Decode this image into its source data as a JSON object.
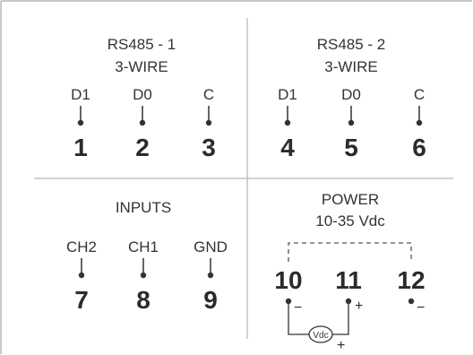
{
  "colors": {
    "border": "#b8b8b8",
    "divider": "#c4c4c4",
    "text": "#333333",
    "dashed_wire": "#555555"
  },
  "sections": {
    "rs485_1": {
      "title": "RS485 - 1",
      "subtitle": "3-WIRE",
      "pins": [
        {
          "label": "D1",
          "number": "1"
        },
        {
          "label": "D0",
          "number": "2"
        },
        {
          "label": "C",
          "number": "3"
        }
      ]
    },
    "rs485_2": {
      "title": "RS485 - 2",
      "subtitle": "3-WIRE",
      "pins": [
        {
          "label": "D1",
          "number": "4"
        },
        {
          "label": "D0",
          "number": "5"
        },
        {
          "label": "C",
          "number": "6"
        }
      ]
    },
    "inputs": {
      "title": "INPUTS",
      "pins": [
        {
          "label": "CH2",
          "number": "7"
        },
        {
          "label": "CH1",
          "number": "8"
        },
        {
          "label": "GND",
          "number": "9"
        }
      ]
    },
    "power": {
      "title": "POWER",
      "subtitle": "10-35 Vdc",
      "terminals": [
        {
          "number": "10",
          "polarity": "−"
        },
        {
          "number": "11",
          "polarity": "+"
        },
        {
          "number": "12",
          "polarity": "−"
        }
      ],
      "source_label": "Vdc",
      "source_polarity": "+"
    }
  }
}
